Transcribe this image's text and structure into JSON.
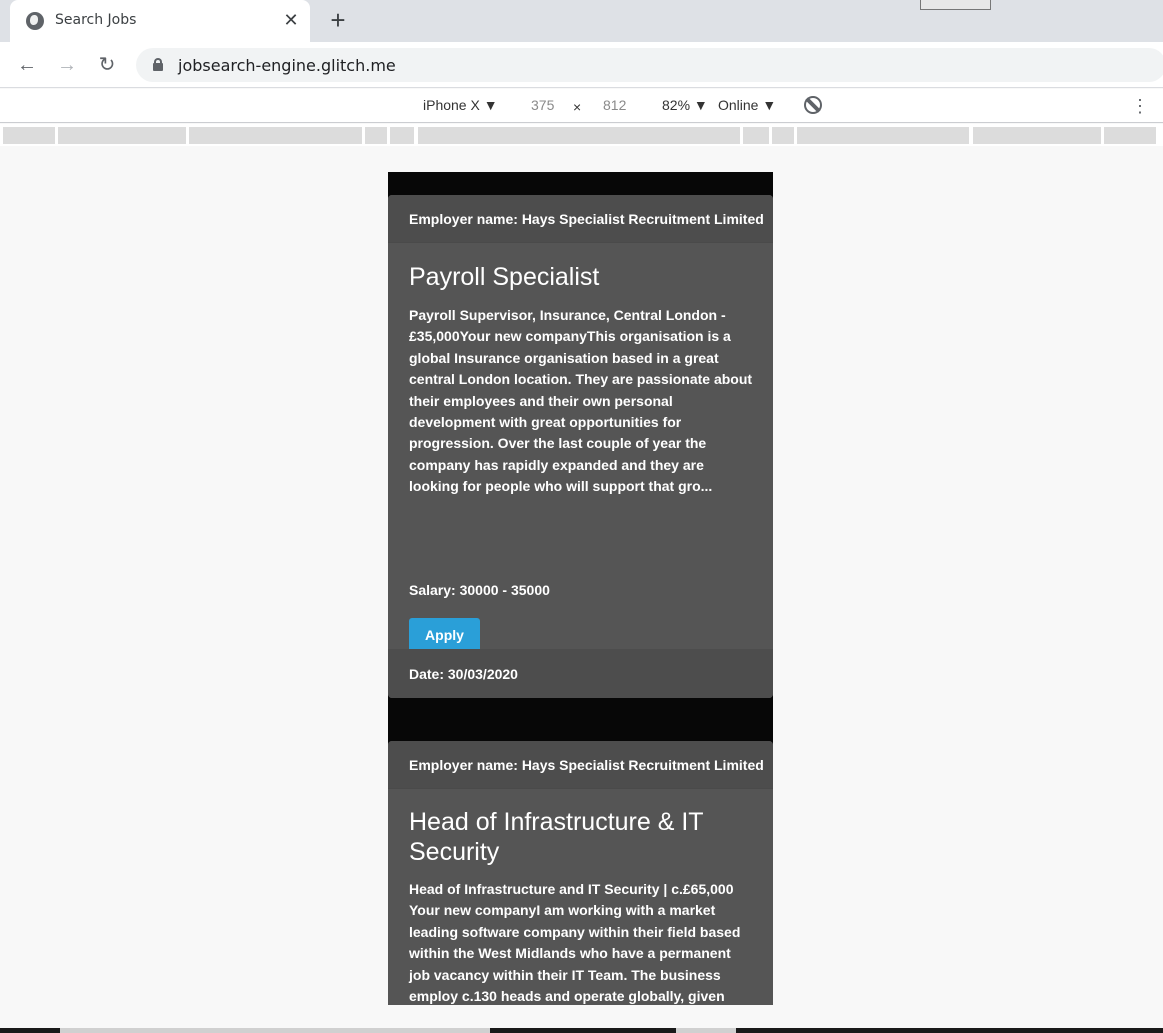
{
  "browser": {
    "tab_title": "Search Jobs",
    "url": "jobsearch-engine.glitch.me"
  },
  "device_toolbar": {
    "device": "iPhone X ▼",
    "width": "375",
    "times": "×",
    "height": "812",
    "zoom": "82% ▼",
    "network": "Online ▼"
  },
  "jobs": [
    {
      "employer": "Employer name: Hays Specialist Recruitment Limited",
      "title": "Payroll Specialist",
      "description": "Payroll Supervisor, Insurance, Central London - £35,000Your new companyThis organisation is a global Insurance organisation based in a great central London location. They are passionate about their employees and their own personal development with great opportunities for progression. Over the last couple of year the company has rapidly expanded and they are looking for people who will support that gro...",
      "salary": "Salary:  30000  -   35000",
      "apply_label": "Apply",
      "date": "Date:  30/03/2020"
    },
    {
      "employer": "Employer name: Hays Specialist Recruitment Limited",
      "title": "Head of Infrastructure & IT Security",
      "description": "Head of Infrastructure and IT Security | c.£65,000 Your new companyI am working with a market leading software company within their field based within the West Midlands who have a permanent job vacancy within their IT Team. The business employ c.130 heads and operate globally, given recent"
    }
  ]
}
